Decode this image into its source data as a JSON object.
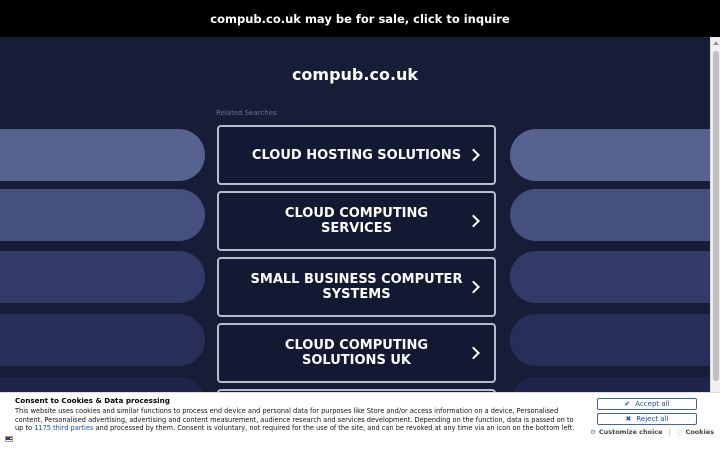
{
  "banner": {
    "text": "compub.co.uk may be for sale, click to inquire"
  },
  "site": {
    "title": "compub.co.uk",
    "related_label": "Related Searches"
  },
  "tiles": [
    {
      "label": "CLOUD HOSTING SOLUTIONS"
    },
    {
      "label": "CLOUD COMPUTING SERVICES"
    },
    {
      "label": "SMALL BUSINESS COMPUTER SYSTEMS"
    },
    {
      "label": "CLOUD COMPUTING SOLUTIONS UK"
    }
  ],
  "cookie": {
    "title": "Consent to Cookies & Data processing",
    "text_before": "This website uses cookies and similar functions to process end device and personal data for purposes like Store and/or access information on a device, Personalised content, Personalised advertising, advertising and content measurement, audience research and services development. Depending on the function, data is passed on to up to ",
    "link_text": "1175 third parties",
    "text_after": " and processed by them. Consent is voluntary, not required for the use of the site, and can be revoked at any time via an icon on the bottom left.",
    "accept_label": "Accept all",
    "reject_label": "Reject all",
    "customize_label": "Customize choice",
    "separator": "|",
    "cookies_label": "Cookies"
  },
  "colors": {
    "background": "#171c37",
    "banner": "#000000",
    "shape_light": "#56628f",
    "shape_mid": "#3d4675",
    "shape_dark": "#2a3159",
    "accent": "#1f4fa8"
  },
  "icons": {
    "tile_chevron": "chevron-right-icon",
    "accept": "check-icon",
    "reject": "x-icon",
    "customize": "gear-icon",
    "cookies": "cookie-icon",
    "flag": "us-flag-icon"
  }
}
